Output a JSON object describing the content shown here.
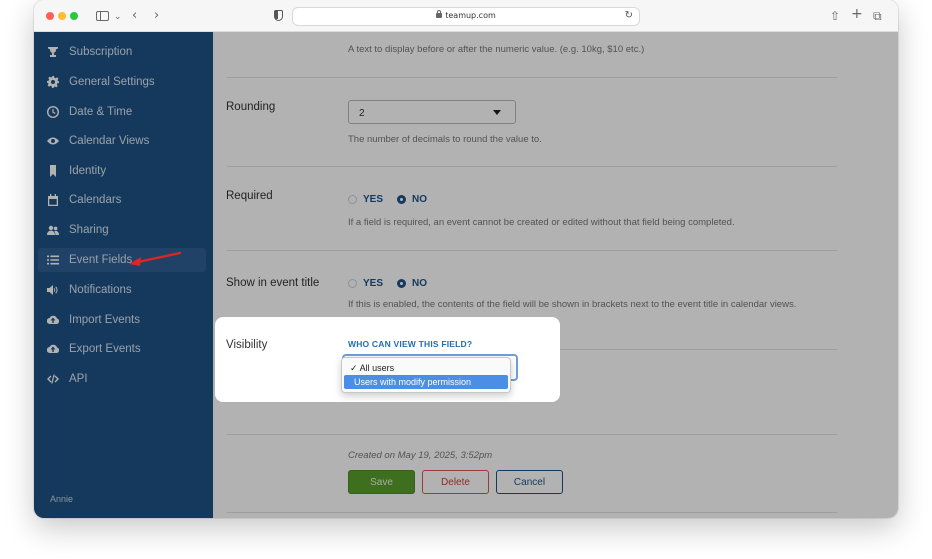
{
  "browser": {
    "url": "teamup.com"
  },
  "sidebar": {
    "items": [
      {
        "label": "Subscription",
        "icon": "trophy-icon"
      },
      {
        "label": "General Settings",
        "icon": "gear-icon"
      },
      {
        "label": "Date & Time",
        "icon": "clock-icon"
      },
      {
        "label": "Calendar Views",
        "icon": "eye-icon"
      },
      {
        "label": "Identity",
        "icon": "bookmark-icon"
      },
      {
        "label": "Calendars",
        "icon": "calendar-icon"
      },
      {
        "label": "Sharing",
        "icon": "users-icon"
      },
      {
        "label": "Event Fields",
        "icon": "list-icon",
        "active": true
      },
      {
        "label": "Notifications",
        "icon": "speaker-icon"
      },
      {
        "label": "Import Events",
        "icon": "cloud-upload-icon"
      },
      {
        "label": "Export Events",
        "icon": "cloud-upload-icon"
      },
      {
        "label": "API",
        "icon": "code-icon"
      }
    ],
    "user": "Annie"
  },
  "form": {
    "prefix_help": "A text to display before or after the numeric value. (e.g. 10kg, $10 etc.)",
    "rounding": {
      "label": "Rounding",
      "value": "2",
      "help": "The number of decimals to round the value to."
    },
    "required": {
      "label": "Required",
      "yes": "YES",
      "no": "NO",
      "selected": "NO",
      "help": "If a field is required, an event cannot be created or edited without that field being completed."
    },
    "show_in_title": {
      "label": "Show in event title",
      "yes": "YES",
      "no": "NO",
      "selected": "NO",
      "help": "If this is enabled, the contents of the field will be shown in brackets next to the event title in calendar views."
    },
    "visibility": {
      "label": "Visibility",
      "heading": "WHO CAN VIEW THIS FIELD?",
      "options": [
        "All users",
        "Users with modify permission"
      ],
      "checked_option": "All users",
      "check_mark": "✓",
      "highlighted_option": "Users with modify permission"
    },
    "created": "Created on May 19, 2025, 3:52pm",
    "buttons": {
      "save": "Save",
      "delete": "Delete",
      "cancel": "Cancel"
    }
  },
  "colors": {
    "sidebar_bg": "#1f5286",
    "accent": "#1f5286",
    "save": "#5aa02c",
    "delete": "#d23a3a",
    "annotation_arrow": "#e02424"
  }
}
